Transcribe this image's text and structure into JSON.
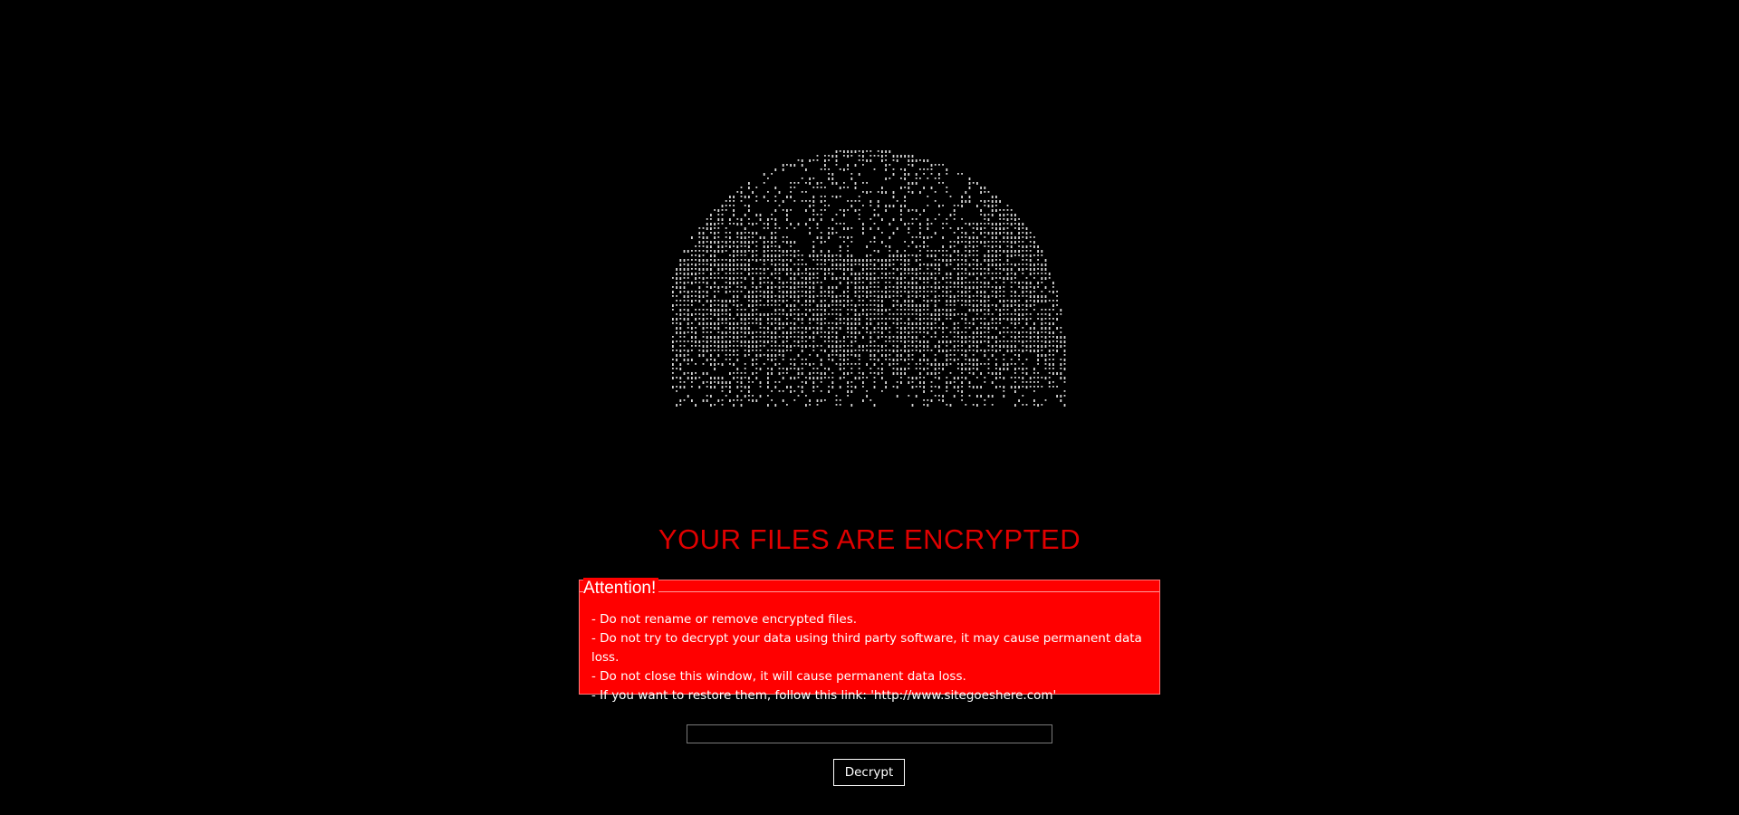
{
  "ascii_art": {
    "icon": "hooded-figure-ascii-art-icon",
    "color": "#d8d8d8"
  },
  "title": "YOUR FILES ARE ENCRYPTED",
  "attention": {
    "legend": "Attention!",
    "items": [
      "- Do not rename or remove encrypted files.",
      "- Do not try to decrypt your data using third party software, it may cause permanent data loss.",
      "- Do not close this window, it will cause permanent data loss.",
      "- If you want to restore them, follow this link: 'http://www.sitegoeshere.com'"
    ]
  },
  "key_input": {
    "value": "",
    "placeholder": ""
  },
  "decrypt_button": "Decrypt",
  "colors": {
    "background": "#000000",
    "title": "#e00000",
    "box": "#ff0000",
    "text": "#ffffff"
  }
}
